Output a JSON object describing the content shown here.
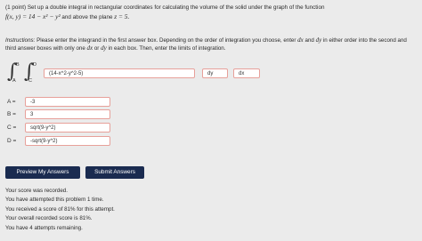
{
  "problem": {
    "prefix": "(1 point)",
    "text": "Set up a double integral in rectangular coordinates for calculating the volume of the solid under the graph of the function",
    "function": "f(x, y) = 14 − x² − y²",
    "middle": "and above the plane",
    "plane": "z = 5."
  },
  "instructions": {
    "label": "Instructions:",
    "part1": "Please enter the integrand in the first answer box. Depending on the order of integration you choose, enter",
    "dx": "dx",
    "and": "and",
    "dy": "dy",
    "part2": "in either order into the second and third answer boxes with only one",
    "dx2": "dx",
    "or": "or",
    "dy2": "dy",
    "part3": "in each box. Then, enter the limits of integration."
  },
  "integral": {
    "upper_outer": "B",
    "lower_outer": "A",
    "upper_inner": "D",
    "lower_inner": "C",
    "integrand_value": "(14-x^2-y^2-5)",
    "differential1_value": "dy",
    "differential2_value": "dx"
  },
  "limits": [
    {
      "label": "A =",
      "value": "-3"
    },
    {
      "label": "B =",
      "value": "3"
    },
    {
      "label": "C =",
      "value": "sqrt(9-y^2)"
    },
    {
      "label": "D =",
      "value": "-sqrt(9-y^2)"
    }
  ],
  "buttons": {
    "preview": "Preview My Answers",
    "submit": "Submit Answers"
  },
  "results": [
    "Your score was recorded.",
    "You have attempted this problem 1 time.",
    "You received a score of 81% for this attempt.",
    "Your overall recorded score is 81%.",
    "You have 4 attempts remaining."
  ],
  "colors": {
    "background": "#ebebeb",
    "button": "#1a2b50",
    "answer_border_incorrect": "#e7a09a"
  }
}
